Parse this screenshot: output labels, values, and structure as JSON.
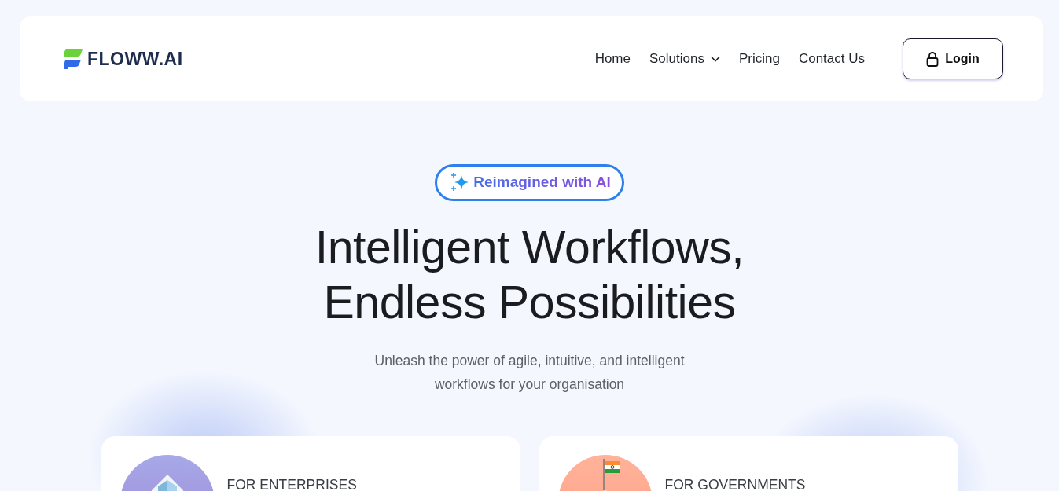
{
  "brand": {
    "name": "FLOWW.AI"
  },
  "nav": [
    {
      "label": "Home",
      "has_menu": false
    },
    {
      "label": "Solutions",
      "has_menu": true
    },
    {
      "label": "Pricing",
      "has_menu": false
    },
    {
      "label": "Contact Us",
      "has_menu": false
    }
  ],
  "login_button": {
    "label": "Login"
  },
  "hero": {
    "badge": "Reimagined with AI",
    "title_lines": [
      "Intelligent Workflows,",
      "Endless Possibilities"
    ],
    "subtitle_lines": [
      "Unleash the power of agile, intuitive, and intelligent",
      "workflows for your organisation"
    ]
  },
  "cards": [
    {
      "kind": "enterprise",
      "label": "FOR ENTERPRISES"
    },
    {
      "kind": "government",
      "label": "FOR GOVERNMENTS"
    }
  ]
}
